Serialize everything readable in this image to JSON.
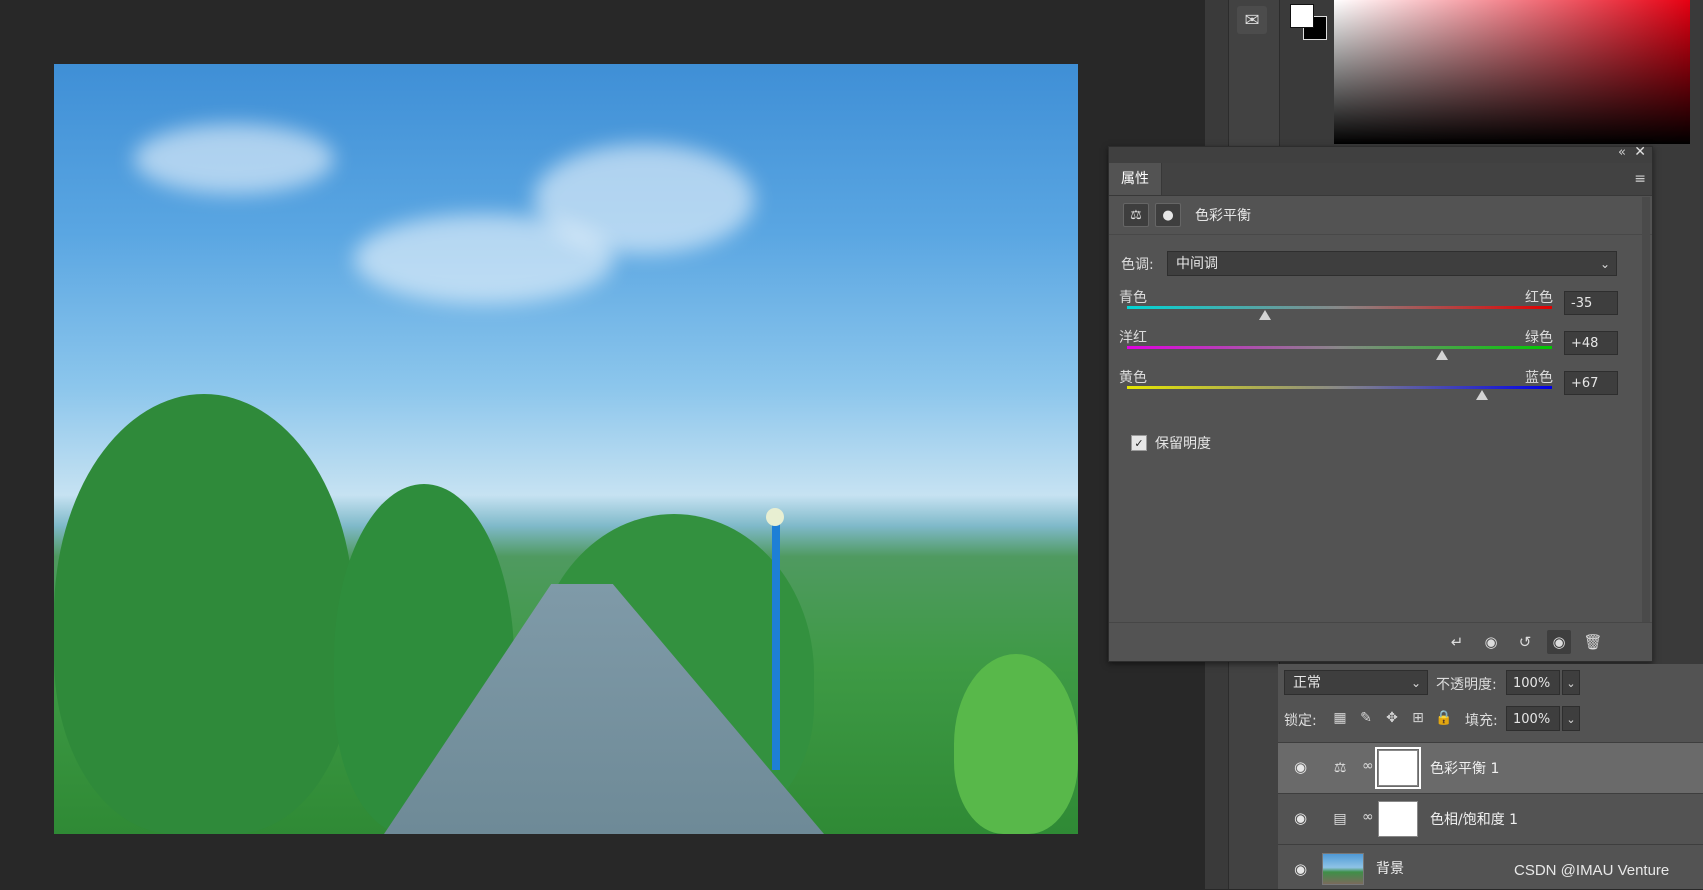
{
  "properties_panel": {
    "tab_label": "属性",
    "adjustment_title": "色彩平衡",
    "tone_label": "色调:",
    "tone_value": "中间调",
    "sliders": [
      {
        "left_label": "青色",
        "right_label": "红色",
        "value": "-35",
        "position_fraction": 0.325,
        "gradient_start": "#00d5d5",
        "gradient_end": "#e00000"
      },
      {
        "left_label": "洋红",
        "right_label": "绿色",
        "value": "+48",
        "position_fraction": 0.74,
        "gradient_start": "#e000e0",
        "gradient_end": "#00c800"
      },
      {
        "left_label": "黄色",
        "right_label": "蓝色",
        "value": "+67",
        "position_fraction": 0.835,
        "gradient_start": "#e6e600",
        "gradient_end": "#0000e6"
      }
    ],
    "preserve_luminosity_label": "保留明度",
    "preserve_luminosity_checked": true
  },
  "layers_panel": {
    "blend_mode": "正常",
    "opacity_label": "不透明度:",
    "opacity_value": "100%",
    "lock_label": "锁定:",
    "fill_label": "填充:",
    "fill_value": "100%",
    "layers": [
      {
        "name": "色彩平衡 1",
        "selected": true,
        "icon": "color-balance-icon"
      },
      {
        "name": "色相/饱和度 1",
        "selected": false,
        "icon": "hue-saturation-icon"
      },
      {
        "name": "背景",
        "selected": false,
        "icon": "image-thumbnail"
      }
    ]
  },
  "colors": {
    "foreground": "#ffffff",
    "background": "#000000",
    "picker_hue": "#e60012"
  },
  "watermark": "CSDN @IMAU Venture"
}
